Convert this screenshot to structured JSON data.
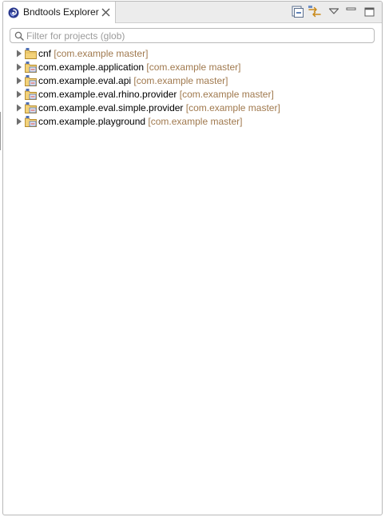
{
  "view": {
    "tab_title": "Bndtools Explorer",
    "icons": {
      "tab": "bndtools-logo-icon",
      "close": "close-icon",
      "collapse_all": "collapse-all-icon",
      "link_with_editor": "link-with-editor-icon",
      "view_menu": "view-menu-icon",
      "minimize": "minimize-icon",
      "maximize": "maximize-icon"
    }
  },
  "filter": {
    "placeholder": "Filter for projects (glob)",
    "value": "",
    "icon": "search-icon"
  },
  "tree": {
    "items": [
      {
        "name": "cnf",
        "decoration": "[com.example master]",
        "icon": "project-folder-icon",
        "expanded": false
      },
      {
        "name": "com.example.application",
        "decoration": "[com.example master]",
        "icon": "bnd-project-icon",
        "expanded": false
      },
      {
        "name": "com.example.eval.api",
        "decoration": "[com.example master]",
        "icon": "bnd-project-icon",
        "expanded": false
      },
      {
        "name": "com.example.eval.rhino.provider",
        "decoration": "[com.example master]",
        "icon": "bnd-project-icon",
        "expanded": false
      },
      {
        "name": "com.example.eval.simple.provider",
        "decoration": "[com.example master]",
        "icon": "bnd-project-icon",
        "expanded": false
      },
      {
        "name": "com.example.playground",
        "decoration": "[com.example master]",
        "icon": "bnd-project-icon",
        "expanded": false
      }
    ]
  },
  "colors": {
    "decoration": "#a0794e",
    "tab_bar": "#ececec",
    "border": "#b8b8b8"
  }
}
